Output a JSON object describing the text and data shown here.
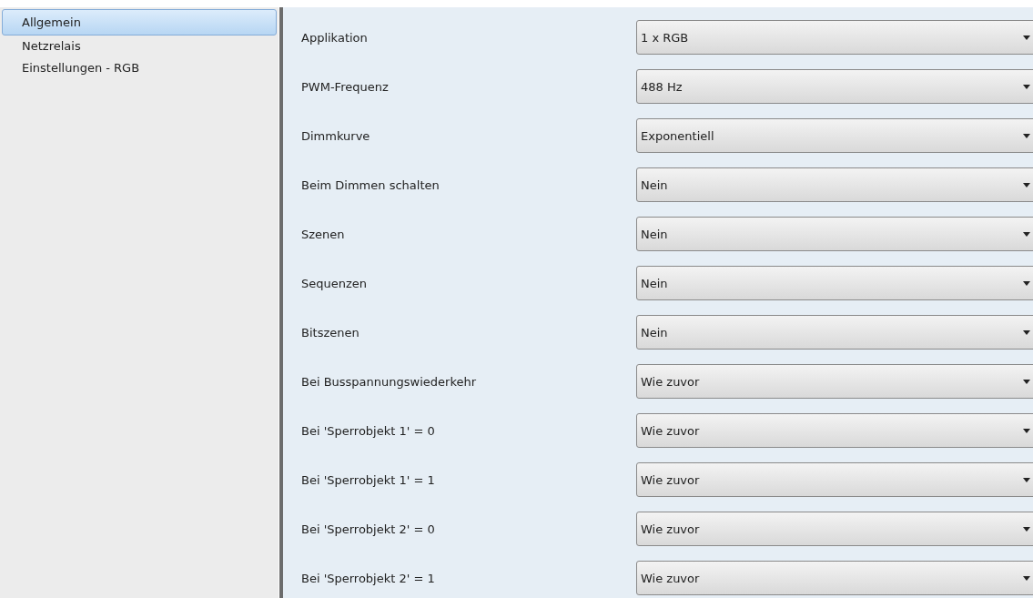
{
  "sidebar": {
    "items": [
      {
        "label": "Allgemein",
        "selected": true
      },
      {
        "label": "Netzrelais",
        "selected": false
      },
      {
        "label": "Einstellungen - RGB",
        "selected": false
      }
    ]
  },
  "parameters": [
    {
      "label": "Applikation",
      "value": "1 x RGB"
    },
    {
      "label": "PWM-Frequenz",
      "value": "488 Hz"
    },
    {
      "label": "Dimmkurve",
      "value": "Exponentiell"
    },
    {
      "label": "Beim Dimmen schalten",
      "value": "Nein"
    },
    {
      "label": "Szenen",
      "value": "Nein"
    },
    {
      "label": "Sequenzen",
      "value": "Nein"
    },
    {
      "label": "Bitszenen",
      "value": "Nein"
    },
    {
      "label": "Bei Busspannungswiederkehr",
      "value": "Wie zuvor"
    },
    {
      "label": "Bei 'Sperrobjekt 1' = 0",
      "value": "Wie zuvor"
    },
    {
      "label": "Bei 'Sperrobjekt 1' = 1",
      "value": "Wie zuvor"
    },
    {
      "label": "Bei 'Sperrobjekt 2' = 0",
      "value": "Wie zuvor"
    },
    {
      "label": "Bei 'Sperrobjekt 2' = 1",
      "value": "Wie zuvor"
    }
  ]
}
